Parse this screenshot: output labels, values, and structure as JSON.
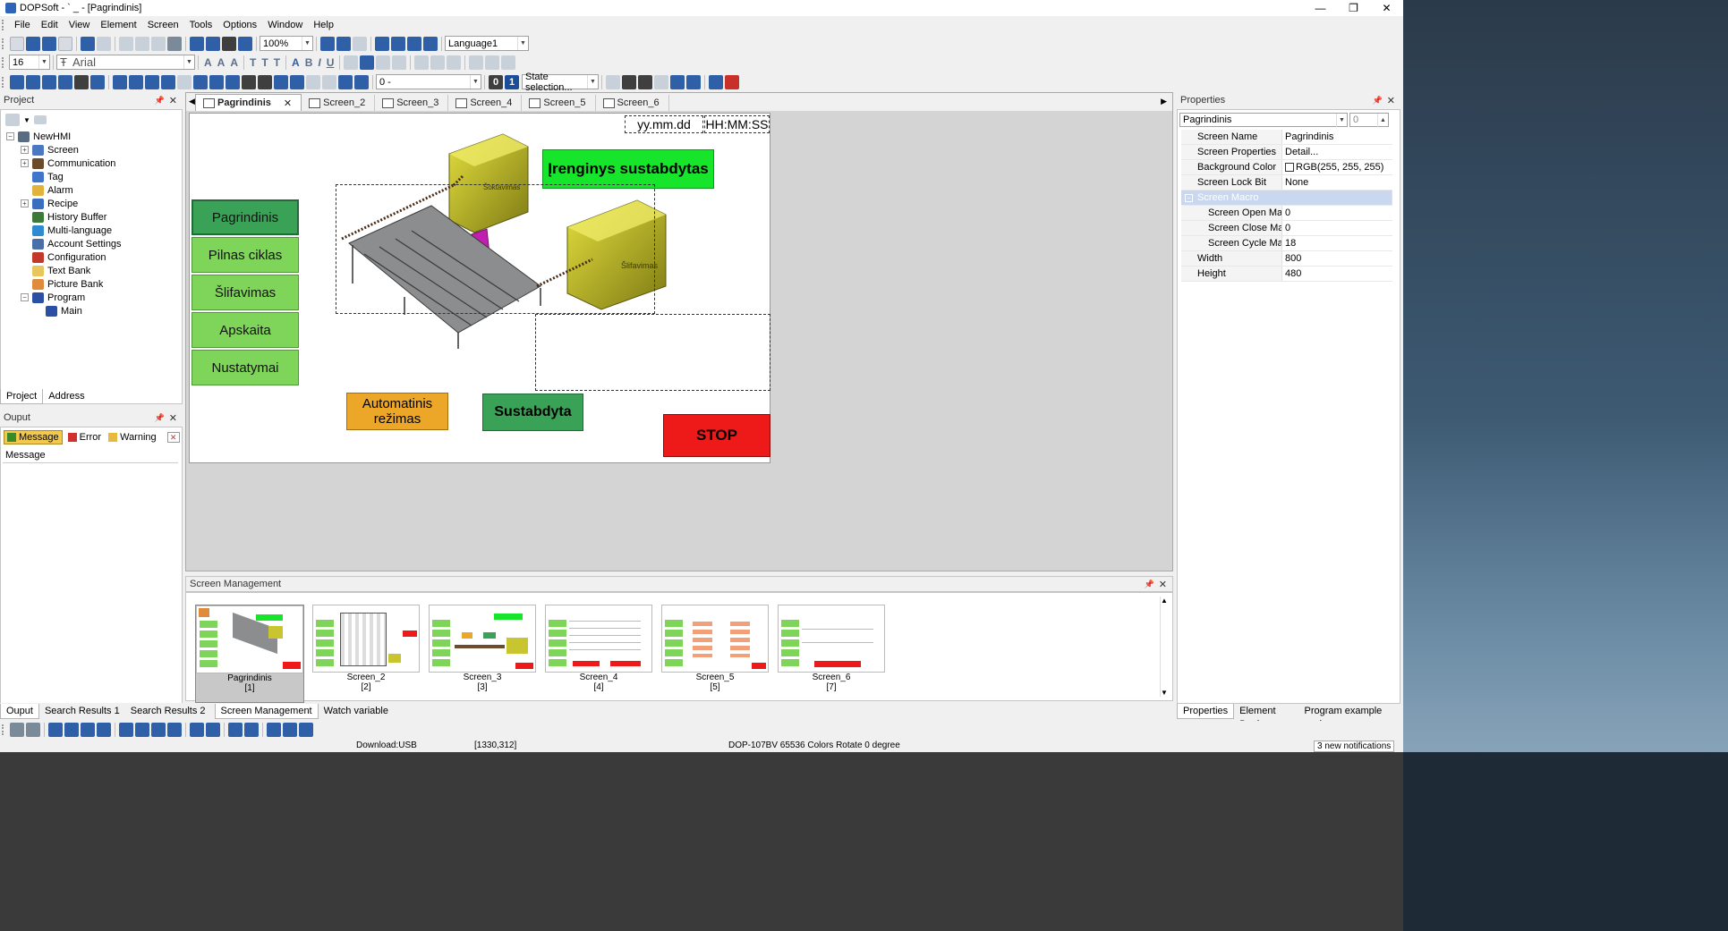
{
  "titlebar": {
    "title": "DOPSoft - `  _  - [Pagrindinis]",
    "minimize": "—",
    "maximize": "❐",
    "close": "✕"
  },
  "menu": [
    "File",
    "Edit",
    "View",
    "Element",
    "Screen",
    "Tools",
    "Options",
    "Window",
    "Help"
  ],
  "toolbar": {
    "zoom": "100%",
    "language": "Language1",
    "font_size": "16",
    "font_name": "Arial",
    "state_value": "0 -",
    "state_selection": "State selection...",
    "zero": "0",
    "one": "1"
  },
  "project_panel": {
    "title": "Project",
    "tree": [
      {
        "label": "NewHMI"
      },
      {
        "label": "Screen"
      },
      {
        "label": "Communication"
      },
      {
        "label": "Tag"
      },
      {
        "label": "Alarm"
      },
      {
        "label": "Recipe"
      },
      {
        "label": "History Buffer"
      },
      {
        "label": "Multi-language"
      },
      {
        "label": "Account Settings"
      },
      {
        "label": "Configuration"
      },
      {
        "label": "Text Bank"
      },
      {
        "label": "Picture Bank"
      },
      {
        "label": "Program"
      },
      {
        "label": "Main"
      }
    ],
    "tabs": [
      "Project",
      "Address"
    ]
  },
  "output_panel": {
    "title": "Ouput",
    "filters": [
      "Message",
      "Error",
      "Warning"
    ],
    "column": "Message"
  },
  "doc_tabs": [
    "Pagrindinis",
    "Screen_2",
    "Screen_3",
    "Screen_4",
    "Screen_5",
    "Screen_6"
  ],
  "canvas": {
    "date": "yy.mm.dd",
    "time": "HH:MM:SS",
    "status_banner": "Įrenginys sustabdytas",
    "nav_buttons": [
      "Pagrindinis",
      "Pilnas ciklas",
      "Šlifavimas",
      "Apskaita",
      "Nustatymai"
    ],
    "auto_button": "Automatinis režimas",
    "stopped_button": "Sustabdyta",
    "stop_button": "STOP",
    "machine_label_1": "Šoktavimas",
    "machine_label_2": "Šlifavimas"
  },
  "properties": {
    "title": "Properties",
    "selector": "Pagrindinis",
    "selector_num": "0",
    "rows": [
      {
        "k": "Screen Name",
        "v": "Pagrindinis"
      },
      {
        "k": "Screen Properties",
        "v": "Detail..."
      },
      {
        "k": "Background Color",
        "v": "RGB(255, 255, 255)"
      },
      {
        "k": "Screen Lock Bit",
        "v": "None"
      },
      {
        "k": "Screen Macro",
        "v": ""
      },
      {
        "k": "Screen Open Mac",
        "v": "0"
      },
      {
        "k": "Screen Close Macr",
        "v": "0"
      },
      {
        "k": "Screen Cycle Macr",
        "v": "18"
      },
      {
        "k": "Width",
        "v": "800"
      },
      {
        "k": "Height",
        "v": "480"
      }
    ],
    "tabs": [
      "Properties",
      "Element Bank",
      "Program example assi..."
    ]
  },
  "screen_management": {
    "title": "Screen Management",
    "thumbs": [
      {
        "name": "Pagrindinis",
        "num": "[1]"
      },
      {
        "name": "Screen_2",
        "num": "[2]"
      },
      {
        "name": "Screen_3",
        "num": "[3]"
      },
      {
        "name": "Screen_4",
        "num": "[4]"
      },
      {
        "name": "Screen_5",
        "num": "[5]"
      },
      {
        "name": "Screen_6",
        "num": "[7]"
      }
    ]
  },
  "bottom_tabs": [
    "Ouput",
    "Search Results 1",
    "Search Results 2",
    "Screen Management",
    "Watch variable"
  ],
  "status": {
    "download": "Download:USB",
    "coords": "[1330,312]",
    "device": "DOP-107BV 65536 Colors Rotate 0 degree",
    "notifications": "3 new notifications"
  },
  "colors": {
    "nav_green": "#7fd45a",
    "nav_selected": "#3aa257",
    "banner_green": "#17e52b",
    "auto_orange": "#eca628",
    "stop_red": "#ee1a1a"
  }
}
